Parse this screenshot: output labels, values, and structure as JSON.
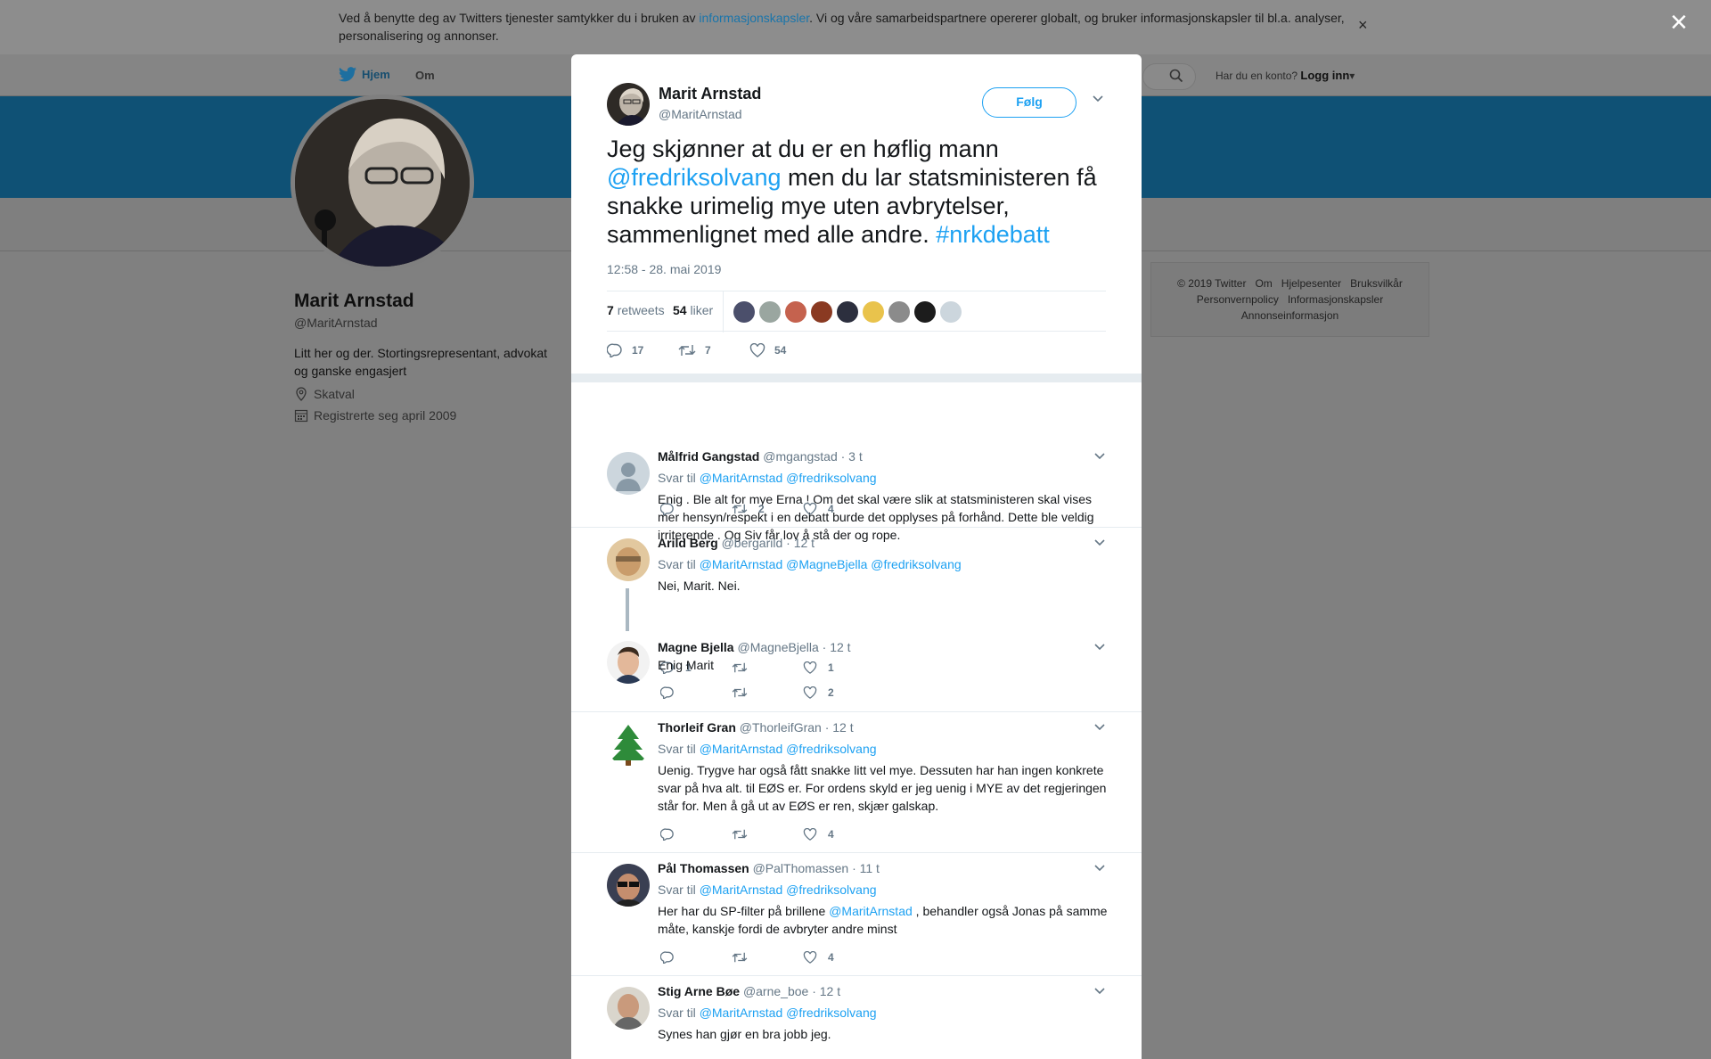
{
  "cookie": {
    "text_before": "Ved å benytte deg av Twitters tjenester samtykker du i bruken av",
    "link": "informasjonskapsler",
    "text_after": ". Vi og våre samarbeidspartnere opererer globalt, og bruker informasjonskapsler til bl.a. analyser, personalisering og annonser.",
    "close": "×"
  },
  "overlay_close": "×",
  "nav": {
    "home": "Hjem",
    "about": "Om",
    "login_prompt": "Har du en konto?",
    "login": "Logg inn"
  },
  "profile": {
    "name": "Marit Arnstad",
    "handle": "@MaritArnstad",
    "bio": "Litt her og der. Stortingsrepresentant, advokat og ganske engasjert",
    "location": "Skatval",
    "joined": "Registrerte seg april 2009"
  },
  "footer": {
    "items": [
      "© 2019 Twitter",
      "Om",
      "Hjelpesenter",
      "Bruksvilkår",
      "Personvernpolicy",
      "Informasjonskapsler",
      "Annonseinformasjon"
    ]
  },
  "tweet": {
    "name": "Marit Arnstad",
    "handle": "@MaritArnstad",
    "follow": "Følg",
    "text_1": "Jeg skjønner at du er en høflig mann",
    "mention": "@fredriksolvang",
    "text_2": " men du lar statsministeren få snakke urimelig mye uten avbrytelser, sammenlignet med alle andre.",
    "hashtag": "#nrkdebatt",
    "time": "12:58 - 28. mai 2019",
    "retweets": "7",
    "retweets_label": "retweets",
    "likes": "54",
    "likes_label": "liker",
    "reply_count": "17",
    "retweet_count": "7",
    "like_count": "54"
  },
  "replies": [
    {
      "name": "Målfrid Gangstad",
      "handle": "@mgangstad",
      "time": "· 3 t",
      "to_label": "Svar til",
      "to": "@MaritArnstad @fredriksolvang",
      "text": "Enig . Ble alt for mye Erna ! Om det skal være slik at statsministeren skal vises mer hensyn/respekt i en debatt burde det opplyses på forhånd. Dette ble veldig irriterende . Og Siv får lov å stå der og rope.",
      "replies": "",
      "retweets": "2",
      "likes": "4"
    },
    {
      "name": "Arild Berg",
      "handle": "@bergarild",
      "time": "· 12 t",
      "to_label": "Svar til",
      "to": "@MaritArnstad @MagneBjella @fredriksolvang",
      "text": "Nei, Marit. Nei.",
      "replies": "1",
      "retweets": "",
      "likes": "1"
    },
    {
      "name": "Magne Bjella",
      "handle": "@MagneBjella",
      "time": "· 12 t",
      "text": "Enig Marit",
      "replies": "",
      "retweets": "",
      "likes": "2"
    },
    {
      "name": "Thorleif Gran",
      "handle": "@ThorleifGran",
      "time": "· 12 t",
      "to_label": "Svar til",
      "to": "@MaritArnstad @fredriksolvang",
      "text": "Uenig. Trygve har også fått snakke litt vel mye. Dessuten har han ingen konkrete svar på hva alt. til EØS er. For ordens skyld er jeg uenig i MYE av det regjeringen står for. Men å gå ut av EØS er ren, skjær galskap.",
      "replies": "",
      "retweets": "",
      "likes": "4"
    },
    {
      "name": "Pål Thomassen",
      "handle": "@PalThomassen",
      "time": "· 11 t",
      "to_label": "Svar til",
      "to": "@MaritArnstad @fredriksolvang",
      "text_before": "Her har du SP-filter på brillene",
      "mention": "@MaritArnstad",
      "text_after": " , behandler også Jonas på samme måte, kanskje fordi de avbryter andre minst",
      "replies": "",
      "retweets": "",
      "likes": "4"
    },
    {
      "name": "Stig Arne Bøe",
      "handle": "@arne_boe",
      "time": "· 12 t",
      "to_label": "Svar til",
      "to": "@MaritArnstad @fredriksolvang",
      "text": "Synes han gjør en bra jobb jeg."
    }
  ]
}
